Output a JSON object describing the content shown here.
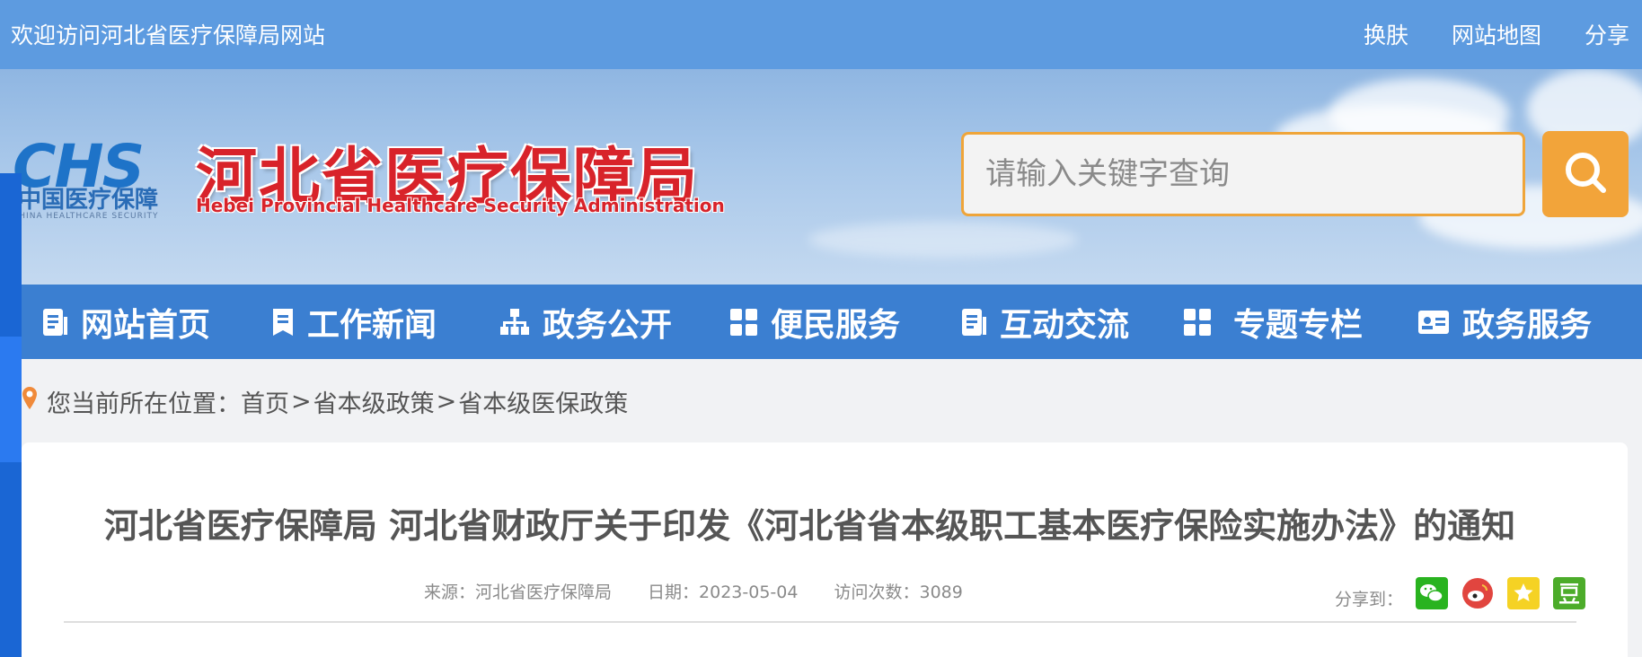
{
  "topbar": {
    "welcome": "欢迎访问河北省医疗保障局网站",
    "links": [
      "换肤",
      "网站地图",
      "分享"
    ]
  },
  "header": {
    "logo_chs": "CHS",
    "logo_cn": "中国医疗保障",
    "logo_en": "CHINA HEALTHCARE SECURITY",
    "title": "河北省医疗保障局",
    "subtitle_en": "Hebei Provincial Healthcare Security Administration",
    "search_placeholder": "请输入关键字查询"
  },
  "nav": {
    "items": [
      {
        "label": "网站首页",
        "icon": "document-icon"
      },
      {
        "label": "工作新闻",
        "icon": "bookmark-doc-icon"
      },
      {
        "label": "政务公开",
        "icon": "org-tree-icon"
      },
      {
        "label": "便民服务",
        "icon": "grid-icon"
      },
      {
        "label": "互动交流",
        "icon": "document-icon"
      },
      {
        "label": "专题专栏",
        "icon": "grid-icon"
      },
      {
        "label": "政务服务",
        "icon": "id-card-icon"
      }
    ]
  },
  "breadcrumb": {
    "prefix": "您当前所在位置：",
    "items": [
      "首页",
      "省本级政策",
      "省本级医保政策"
    ],
    "separator": ">"
  },
  "article": {
    "title": "河北省医疗保障局 河北省财政厅关于印发《河北省省本级职工基本医疗保险实施办法》的通知",
    "source_label": "来源：",
    "source": "河北省医疗保障局",
    "date_label": "日期：",
    "date": "2023-05-04",
    "visits_label": "访问次数：",
    "visits": "3089",
    "share_label": "分享到：",
    "share_icons": [
      "wechat-icon",
      "weibo-icon",
      "qzone-icon",
      "douban-icon"
    ]
  },
  "colors": {
    "topbar": "#5d9be0",
    "nav": "#3b7fd1",
    "title_red": "#d8232a",
    "search_orange": "#f2a43a"
  }
}
